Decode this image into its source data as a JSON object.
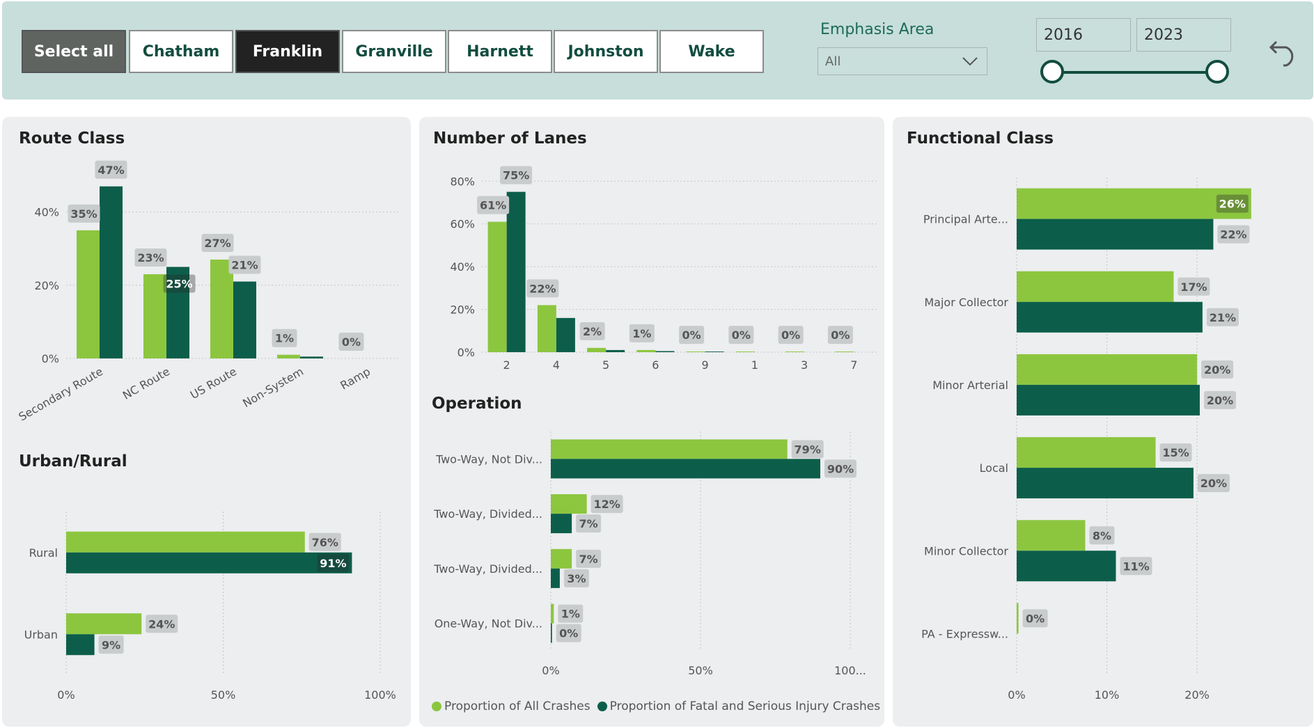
{
  "colors": {
    "all": "#8cc63f",
    "fatal": "#0c5e4a",
    "label_bg": "#c9cccd",
    "label_text": "#555555"
  },
  "filters": {
    "select_all": "Select all",
    "counties": [
      "Chatham",
      "Franklin",
      "Granville",
      "Harnett",
      "Johnston",
      "Wake"
    ],
    "selected": "Franklin",
    "emphasis_title": "Emphasis Area",
    "emphasis_value": "All",
    "year_start": "2016",
    "year_end": "2023"
  },
  "legend": {
    "all": "Proportion of All Crashes",
    "fatal": "Proportion of Fatal and Serious Injury Crashes"
  },
  "chart_data": [
    {
      "id": "route",
      "type": "bar",
      "title": "Route Class",
      "categories": [
        "Secondary Route",
        "NC Route",
        "US Route",
        "Non-System",
        "Ramp"
      ],
      "series": [
        {
          "name": "Proportion of All Crashes",
          "values": [
            35,
            23,
            27,
            1,
            0
          ]
        },
        {
          "name": "Proportion of Fatal and Serious Injury Crashes",
          "values": [
            47,
            25,
            21,
            0.5,
            0
          ]
        }
      ],
      "labels_all": [
        "35%",
        "23%",
        "27%",
        "1%",
        "0%"
      ],
      "labels_fatal": [
        "47%",
        "25%",
        "21%",
        "",
        ""
      ],
      "yticks": [
        "0%",
        "20%",
        "40%"
      ],
      "ylim": [
        0,
        50
      ]
    },
    {
      "id": "lanes",
      "type": "bar",
      "title": "Number of Lanes",
      "categories": [
        "2",
        "4",
        "5",
        "6",
        "9",
        "1",
        "3",
        "7"
      ],
      "series": [
        {
          "name": "Proportion of All Crashes",
          "values": [
            61,
            22,
            2,
            1,
            0.3,
            0.3,
            0.3,
            0.3
          ]
        },
        {
          "name": "Proportion of Fatal and Serious Injury Crashes",
          "values": [
            75,
            16,
            1,
            0.5,
            0.3,
            0,
            0,
            0
          ]
        }
      ],
      "labels_all": [
        "61%",
        "22%",
        "2%",
        "1%",
        "0%",
        "0%",
        "0%",
        "0%"
      ],
      "labels_fatal": [
        "75%",
        "",
        "",
        "",
        "",
        "",
        "",
        ""
      ],
      "yticks": [
        "0%",
        "20%",
        "40%",
        "60%",
        "80%"
      ],
      "ylim": [
        0,
        84
      ]
    },
    {
      "id": "urban",
      "type": "bar",
      "title": "Urban/Rural",
      "categories": [
        "Rural",
        "Urban"
      ],
      "series": [
        {
          "name": "Proportion of All Crashes",
          "values": [
            76,
            24
          ]
        },
        {
          "name": "Proportion of Fatal and Serious Injury Crashes",
          "values": [
            91,
            9
          ]
        }
      ],
      "labels_all": [
        "76%",
        "24%"
      ],
      "labels_fatal": [
        "91%",
        "9%"
      ],
      "xticks": [
        "0%",
        "50%",
        "100%"
      ],
      "xlim": [
        0,
        100
      ]
    },
    {
      "id": "operation",
      "type": "bar",
      "title": "Operation",
      "categories": [
        "Two-Way, Not Div...",
        "Two-Way, Divided...",
        "Two-Way, Divided...",
        "One-Way, Not Div..."
      ],
      "series": [
        {
          "name": "Proportion of All Crashes",
          "values": [
            79,
            12,
            7,
            1
          ]
        },
        {
          "name": "Proportion of Fatal and Serious Injury Crashes",
          "values": [
            90,
            7,
            3,
            0.4
          ]
        }
      ],
      "labels_all": [
        "79%",
        "12%",
        "7%",
        "1%"
      ],
      "labels_fatal": [
        "90%",
        "7%",
        "3%",
        "0%"
      ],
      "xticks": [
        "0%",
        "50%",
        "100..."
      ],
      "xlim": [
        0,
        100
      ]
    },
    {
      "id": "functional",
      "type": "bar",
      "title": "Functional Class",
      "categories": [
        "Principal Arte...",
        "Major Collector",
        "Minor Arterial",
        "Local",
        "Minor Collector",
        "PA - Expressw..."
      ],
      "series": [
        {
          "name": "Proportion of All Crashes",
          "values": [
            26,
            17.4,
            20,
            15.4,
            7.6,
            0.2
          ]
        },
        {
          "name": "Proportion of Fatal and Serious Injury Crashes",
          "values": [
            21.8,
            20.6,
            20.3,
            19.6,
            11,
            0
          ]
        }
      ],
      "labels_all": [
        "26%",
        "17%",
        "20%",
        "15%",
        "8%",
        "0%"
      ],
      "labels_fatal": [
        "22%",
        "21%",
        "20%",
        "20%",
        "11%",
        ""
      ],
      "xticks": [
        "0%",
        "10%",
        "20%"
      ],
      "xlim": [
        0,
        26.4
      ]
    }
  ]
}
